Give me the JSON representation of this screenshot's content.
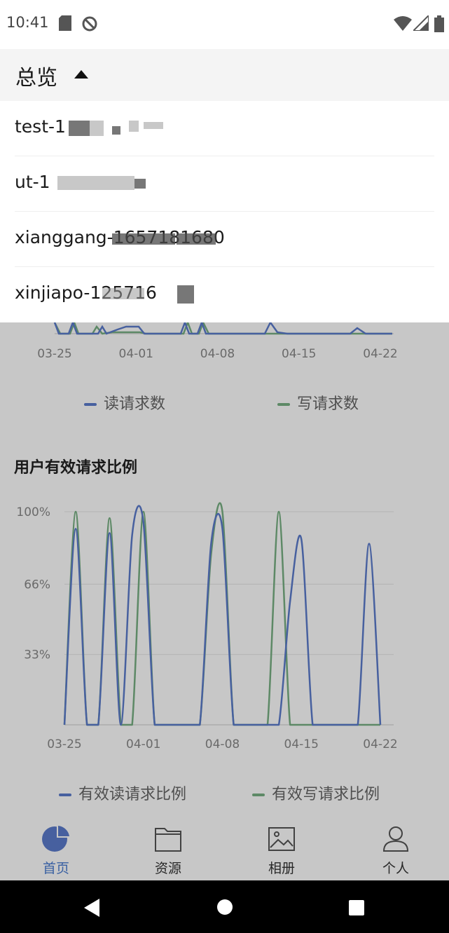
{
  "status_bar": {
    "time": "10:41"
  },
  "dropdown": {
    "title": "总览",
    "items": [
      {
        "label": "test-1"
      },
      {
        "label": "ut-1"
      },
      {
        "label": "xianggang-1657181680"
      },
      {
        "label": "xinjiapo-125716"
      }
    ]
  },
  "colors": {
    "blue": "#5b7ccc",
    "green": "#78b083",
    "accent": "#4a7bd0"
  },
  "chart1": {
    "x_ticks": [
      "03-25",
      "04-01",
      "04-08",
      "04-15",
      "04-22"
    ],
    "legend": [
      "读请求数",
      "写请求数"
    ]
  },
  "chart2": {
    "title": "用户有效请求比例",
    "y_ticks": [
      "100%",
      "66%",
      "33%"
    ],
    "x_ticks": [
      "03-25",
      "04-01",
      "04-08",
      "04-15",
      "04-22"
    ],
    "legend": [
      "有效读请求比例",
      "有效写请求比例"
    ]
  },
  "chart_data": {
    "type": "line",
    "title": "用户有效请求比例",
    "xlabel": "",
    "ylabel": "",
    "x": [
      "03-25",
      "03-26",
      "03-27",
      "03-28",
      "03-29",
      "03-30",
      "03-31",
      "04-01",
      "04-02",
      "04-03",
      "04-04",
      "04-05",
      "04-06",
      "04-07",
      "04-08",
      "04-09",
      "04-10",
      "04-11",
      "04-12",
      "04-13",
      "04-14",
      "04-15",
      "04-16",
      "04-17",
      "04-18",
      "04-19",
      "04-20",
      "04-21",
      "04-22"
    ],
    "ylim": [
      0,
      100
    ],
    "grid": true,
    "legend_position": "bottom",
    "series": [
      {
        "name": "有效读请求比例",
        "values": [
          0,
          92,
          0,
          0,
          90,
          0,
          89,
          95,
          0,
          0,
          0,
          0,
          0,
          85,
          92,
          0,
          0,
          0,
          0,
          0,
          58,
          87,
          0,
          0,
          0,
          0,
          0,
          85,
          0
        ]
      },
      {
        "name": "有效写请求比例",
        "values": [
          0,
          100,
          0,
          0,
          97,
          0,
          0,
          100,
          0,
          0,
          0,
          0,
          0,
          80,
          100,
          0,
          0,
          0,
          0,
          100,
          0,
          0,
          0,
          0,
          0,
          0,
          0,
          0,
          0
        ]
      }
    ]
  },
  "tabs": [
    {
      "label": "首页",
      "icon": "pie-chart-icon",
      "active": true
    },
    {
      "label": "资源",
      "icon": "folder-icon",
      "active": false
    },
    {
      "label": "相册",
      "icon": "image-icon",
      "active": false
    },
    {
      "label": "个人",
      "icon": "person-icon",
      "active": false
    }
  ]
}
